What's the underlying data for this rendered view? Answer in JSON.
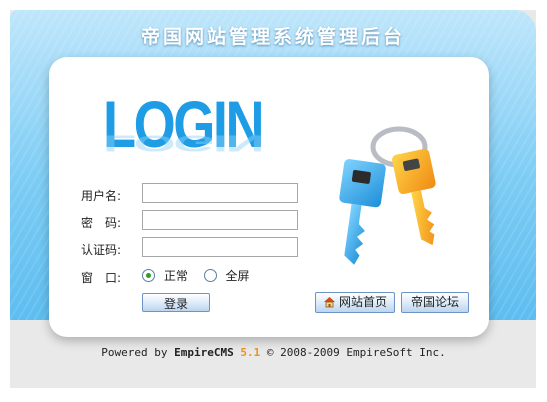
{
  "header": {
    "title": "帝国网站管理系统管理后台"
  },
  "logo": {
    "text": "LOGIN"
  },
  "form": {
    "username": {
      "label": "用户名:",
      "value": ""
    },
    "password": {
      "label": "密　码:",
      "value": ""
    },
    "captcha": {
      "label": "认证码:",
      "value": ""
    },
    "window_mode": {
      "label": "窗　口:",
      "options": [
        {
          "label": "正常",
          "selected": true
        },
        {
          "label": "全屏",
          "selected": false
        }
      ]
    },
    "submit_label": "登录"
  },
  "links": {
    "home_label": "网站首页",
    "forum_label": "帝国论坛"
  },
  "footer": {
    "powered_by": "Powered by",
    "brand": "EmpireCMS",
    "version": "5.1",
    "copyright": "© 2008-2009 EmpireSoft Inc."
  },
  "colors": {
    "accent": "#1e9de6",
    "panel": "#5dbdf0",
    "version": "#e8931a"
  }
}
